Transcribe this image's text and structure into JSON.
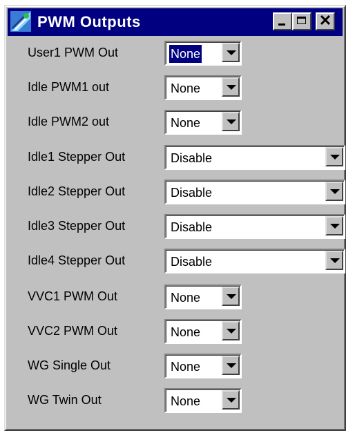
{
  "window": {
    "title": "PWM Outputs",
    "icon": "app-icon"
  },
  "rows": [
    {
      "label": "User1 PWM Out",
      "value": "None",
      "focused": true
    },
    {
      "label": "Idle PWM1 out",
      "value": "None"
    },
    {
      "label": "Idle PWM2 out",
      "value": "None"
    },
    {
      "label": "Idle1 Stepper Out",
      "value": "Disable"
    },
    {
      "label": "Idle2 Stepper Out",
      "value": "Disable"
    },
    {
      "label": "Idle3 Stepper Out",
      "value": "Disable"
    },
    {
      "label": "Idle4 Stepper Out",
      "value": "Disable"
    },
    {
      "label": "VVC1 PWM Out",
      "value": "None"
    },
    {
      "label": "VVC2 PWM Out",
      "value": "None"
    },
    {
      "label": "WG Single Out",
      "value": "None"
    },
    {
      "label": "WG Twin Out",
      "value": "None"
    }
  ],
  "colors": {
    "titlebar": "#000080",
    "face": "#c0c0c0",
    "selection": "#000080"
  }
}
